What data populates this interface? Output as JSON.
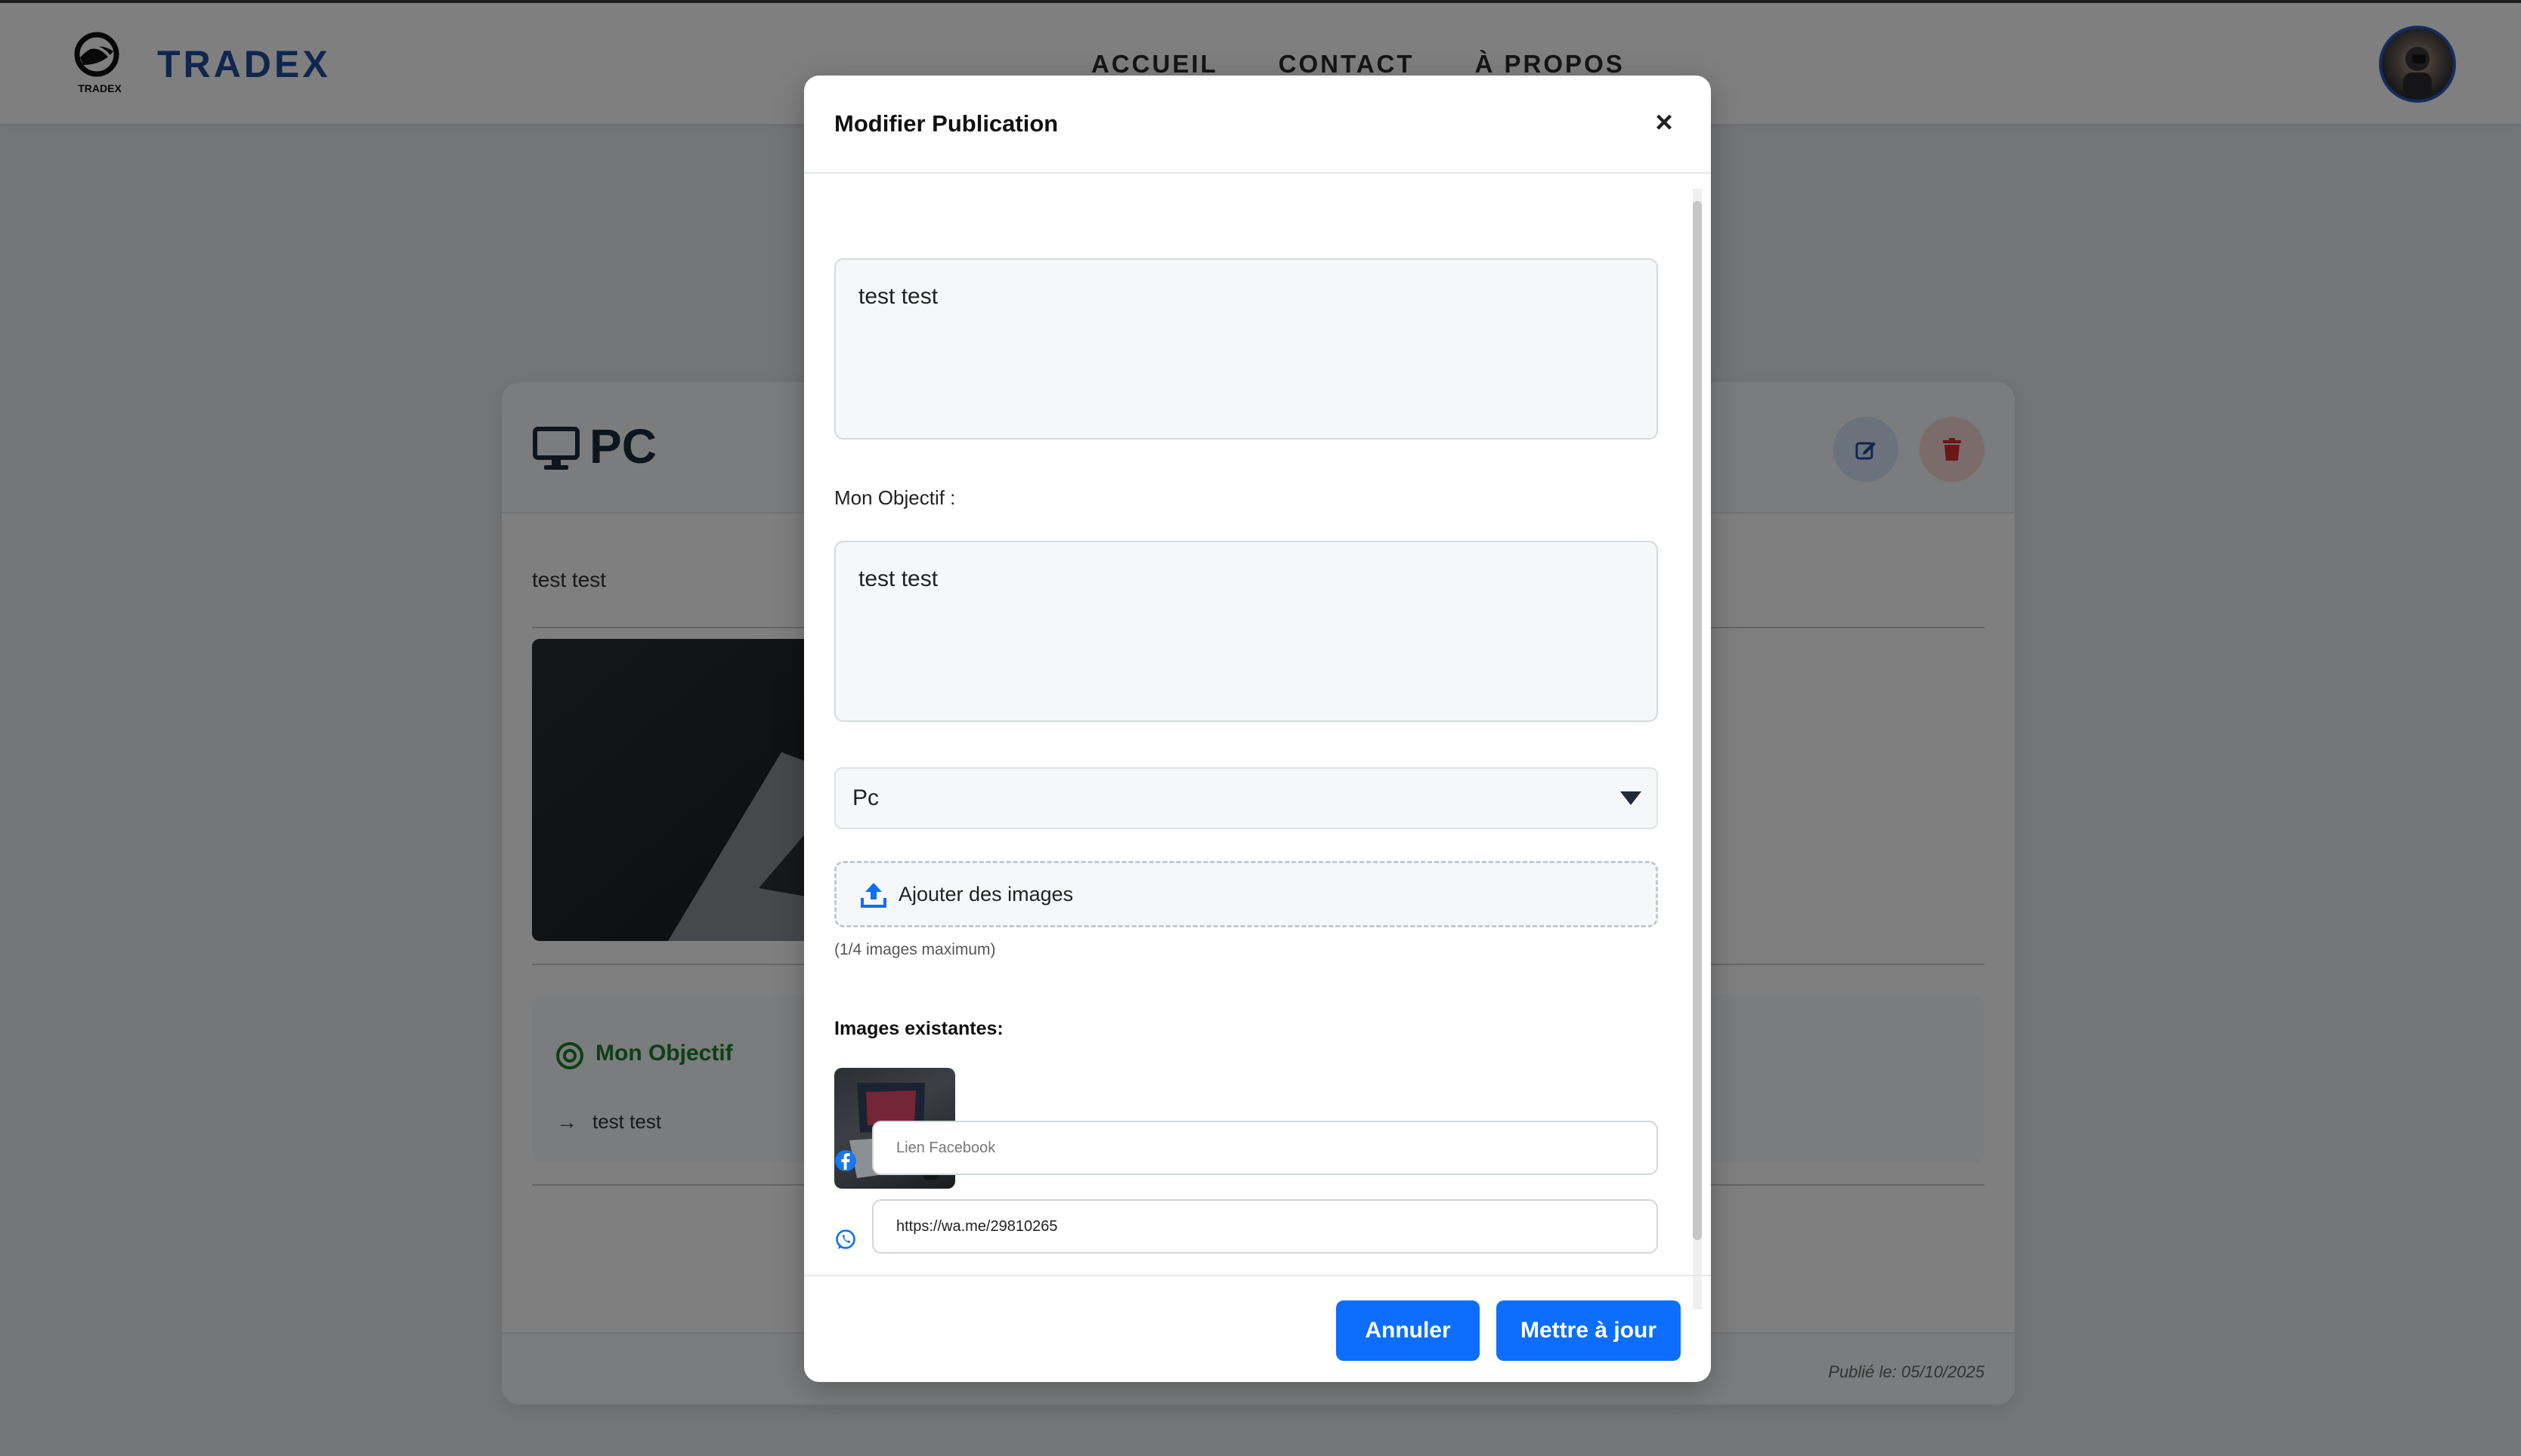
{
  "header": {
    "brand": "TRADEX",
    "logo_subtext": "TRADEX",
    "nav": [
      "ACCUEIL",
      "CONTACT",
      "À PROPOS"
    ]
  },
  "card": {
    "title": "PC",
    "description": "test test",
    "objective_title": "Mon Objectif",
    "objective_text": "test test",
    "published": "Publié le: 05/10/2025"
  },
  "modal": {
    "title": "Modifier Publication",
    "close_symbol": "×",
    "description_value": "test test",
    "objective_label": "Mon Objectif :",
    "objective_value": "test test",
    "category_value": "Pc",
    "upload_label": "Ajouter des images",
    "upload_hint": "(1/4 images maximum)",
    "existing_images_label": "Images existantes:",
    "facebook_placeholder": "Lien Facebook",
    "facebook_value": "",
    "whatsapp_value": "https://wa.me/29810265",
    "cancel_label": "Annuler",
    "update_label": "Mettre à jour"
  },
  "colors": {
    "accent": "#0d6efd",
    "brand": "#1f4e9e",
    "objective_green": "#1a7f2a",
    "delete_red": "#d32f2f"
  },
  "icons": [
    "logo-icon",
    "monitor-icon",
    "edit-icon",
    "trash-icon",
    "target-icon",
    "arrow-right-icon",
    "close-icon",
    "chevron-down-icon",
    "upload-icon",
    "facebook-icon",
    "whatsapp-icon"
  ]
}
